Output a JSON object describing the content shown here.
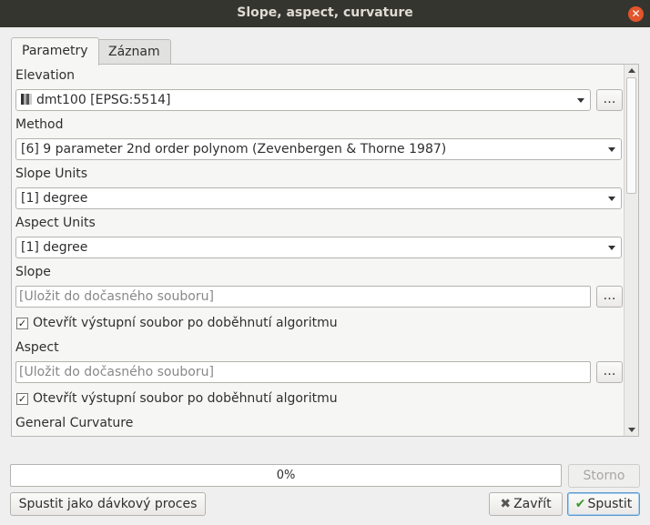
{
  "window": {
    "title": "Slope, aspect, curvature"
  },
  "tabs": [
    {
      "label": "Parametry",
      "active": true
    },
    {
      "label": "Záznam",
      "active": false
    }
  ],
  "params": {
    "elevation": {
      "label": "Elevation",
      "value": "dmt100 [EPSG:5514]",
      "browse_label": "…"
    },
    "method": {
      "label": "Method",
      "value": "[6] 9 parameter 2nd order polynom (Zevenbergen & Thorne 1987)"
    },
    "slope_units": {
      "label": "Slope Units",
      "value": "[1] degree"
    },
    "aspect_units": {
      "label": "Aspect Units",
      "value": "[1] degree"
    },
    "slope": {
      "label": "Slope",
      "placeholder": "[Uložit do dočasného souboru]",
      "browse_label": "…",
      "open_output_label": "Otevřít výstupní soubor po doběhnutí algoritmu",
      "open_output_checked": true
    },
    "aspect": {
      "label": "Aspect",
      "placeholder": "[Uložit do dočasného souboru]",
      "browse_label": "…",
      "open_output_label": "Otevřít výstupní soubor po doběhnutí algoritmu",
      "open_output_checked": true
    },
    "general_curvature": {
      "label": "General Curvature"
    }
  },
  "progress": {
    "percent": 0,
    "text": "0%"
  },
  "buttons": {
    "cancel": "Storno",
    "batch": "Spustit jako dávkový proces",
    "close": "Zavřít",
    "run": "Spustit"
  }
}
